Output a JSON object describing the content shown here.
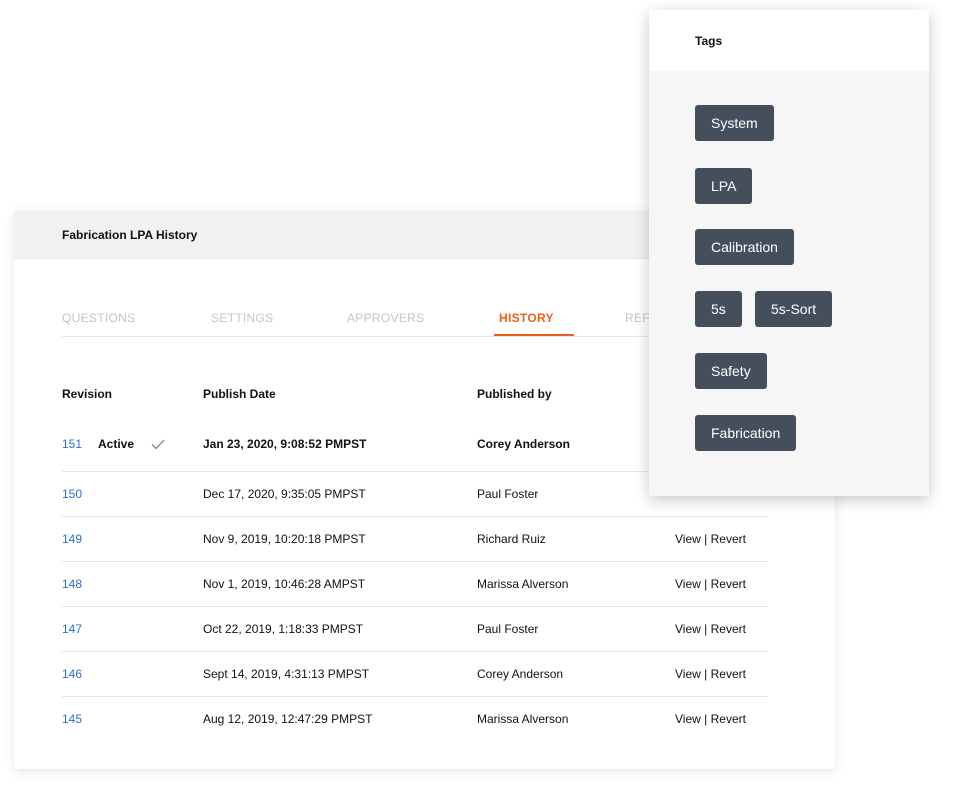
{
  "card": {
    "title": "Fabrication LPA History"
  },
  "tabs": [
    {
      "label": "QUESTIONS"
    },
    {
      "label": "SETTINGS"
    },
    {
      "label": "APPROVERS"
    },
    {
      "label": "HISTORY",
      "active": true
    },
    {
      "label": "REF"
    }
  ],
  "table": {
    "headers": {
      "revision": "Revision",
      "publish_date": "Publish Date",
      "published_by": "Published by"
    },
    "active_label": "Active",
    "rows": [
      {
        "revision": "151",
        "date": "Jan 23, 2020, 9:08:52 PMPST",
        "by": "Corey Anderson",
        "active": true
      },
      {
        "revision": "150",
        "date": "Dec 17, 2020, 9:35:05 PMPST",
        "by": "Paul Foster"
      },
      {
        "revision": "149",
        "date": "Nov 9, 2019, 10:20:18 PMPST",
        "by": "Richard Ruiz",
        "view": "View",
        "sep": "|",
        "revert": "Revert"
      },
      {
        "revision": "148",
        "date": "Nov 1, 2019, 10:46:28 AMPST",
        "by": "Marissa Alverson",
        "view": "View",
        "sep": "|",
        "revert": "Revert"
      },
      {
        "revision": "147",
        "date": "Oct 22, 2019, 1:18:33 PMPST",
        "by": "Paul Foster",
        "view": "View",
        "sep": "|",
        "revert": "Revert"
      },
      {
        "revision": "146",
        "date": "Sept 14, 2019, 4:31:13 PMPST",
        "by": "Corey Anderson",
        "view": "View",
        "sep": "|",
        "revert": "Revert"
      },
      {
        "revision": "145",
        "date": "Aug 12, 2019, 12:47:29 PMPST",
        "by": "Marissa Alverson",
        "view": "View",
        "sep": "|",
        "revert": "Revert"
      }
    ]
  },
  "tags_panel": {
    "title": "Tags",
    "tags": [
      "System",
      "LPA",
      "Calibration",
      "5s",
      "5s-Sort",
      "Safety",
      "Fabrication"
    ]
  },
  "colors": {
    "accent": "#e8601c",
    "link": "#2a6fd1",
    "tag_bg": "#454f5b"
  }
}
